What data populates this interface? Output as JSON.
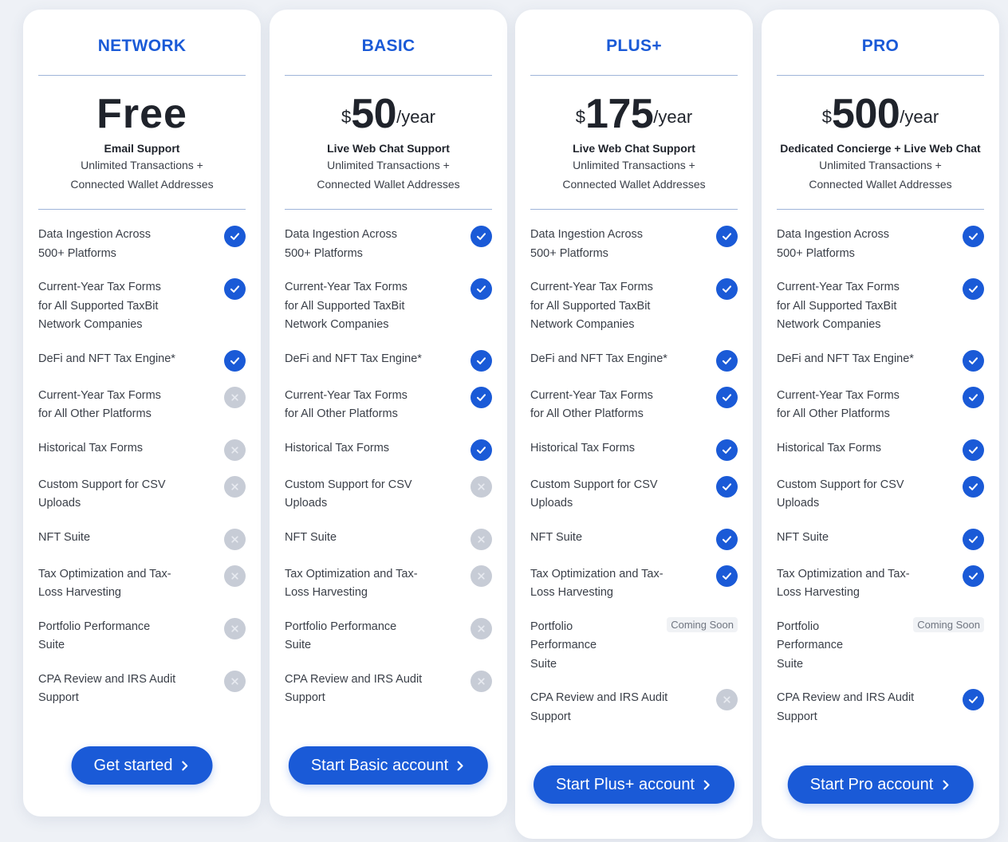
{
  "colors": {
    "accent": "#1a5ad7",
    "disabled": "#c7ccd6"
  },
  "plans": [
    {
      "tier": "NETWORK",
      "price": {
        "free_label": "Free",
        "currency": "",
        "amount": "",
        "period": ""
      },
      "support": "Email Support",
      "sub1": "Unlimited Transactions +",
      "sub2": "Connected Wallet Addresses",
      "features": [
        {
          "lines": [
            "Data Ingestion Across",
            "500+ Platforms"
          ],
          "status": "check-icon"
        },
        {
          "lines": [
            "Current-Year Tax Forms",
            "for All Supported TaxBit",
            "Network Companies"
          ],
          "status": "check-icon"
        },
        {
          "lines": [
            "DeFi and NFT Tax Engine*"
          ],
          "status": "check-icon"
        },
        {
          "lines": [
            "Current-Year Tax Forms",
            "for All Other Platforms"
          ],
          "status": "x-icon"
        },
        {
          "lines": [
            "Historical Tax Forms"
          ],
          "status": "x-icon"
        },
        {
          "lines": [
            "Custom Support for CSV",
            "Uploads"
          ],
          "status": "x-icon"
        },
        {
          "lines": [
            "NFT Suite"
          ],
          "status": "x-icon"
        },
        {
          "lines": [
            "Tax Optimization and Tax-",
            "Loss Harvesting"
          ],
          "status": "x-icon"
        },
        {
          "lines": [
            "Portfolio Performance",
            "Suite"
          ],
          "status": "x-icon"
        },
        {
          "lines": [
            "CPA Review and IRS Audit",
            "Support"
          ],
          "status": "x-icon"
        }
      ],
      "cta": "Get started"
    },
    {
      "tier": "BASIC",
      "price": {
        "free_label": "",
        "currency": "$",
        "amount": "50",
        "period": "/year"
      },
      "support": "Live Web Chat Support",
      "sub1": "Unlimited Transactions +",
      "sub2": "Connected Wallet Addresses",
      "features": [
        {
          "lines": [
            "Data Ingestion Across",
            "500+ Platforms"
          ],
          "status": "check-icon"
        },
        {
          "lines": [
            "Current-Year Tax Forms",
            "for All Supported TaxBit",
            "Network Companies"
          ],
          "status": "check-icon"
        },
        {
          "lines": [
            "DeFi and NFT Tax Engine*"
          ],
          "status": "check-icon"
        },
        {
          "lines": [
            "Current-Year Tax Forms",
            "for All Other Platforms"
          ],
          "status": "check-icon"
        },
        {
          "lines": [
            "Historical Tax Forms"
          ],
          "status": "check-icon"
        },
        {
          "lines": [
            "Custom Support for CSV",
            "Uploads"
          ],
          "status": "x-icon"
        },
        {
          "lines": [
            "NFT Suite"
          ],
          "status": "x-icon"
        },
        {
          "lines": [
            "Tax Optimization and Tax-",
            "Loss Harvesting"
          ],
          "status": "x-icon"
        },
        {
          "lines": [
            "Portfolio Performance",
            "Suite"
          ],
          "status": "x-icon"
        },
        {
          "lines": [
            "CPA Review and IRS Audit",
            "Support"
          ],
          "status": "x-icon"
        }
      ],
      "cta": "Start Basic account"
    },
    {
      "tier": "PLUS+",
      "price": {
        "free_label": "",
        "currency": "$",
        "amount": "175",
        "period": "/year"
      },
      "support": "Live Web Chat Support",
      "sub1": "Unlimited Transactions +",
      "sub2": "Connected Wallet Addresses",
      "features": [
        {
          "lines": [
            "Data Ingestion Across",
            "500+ Platforms"
          ],
          "status": "check-icon"
        },
        {
          "lines": [
            "Current-Year Tax Forms",
            "for All Supported TaxBit",
            "Network Companies"
          ],
          "status": "check-icon"
        },
        {
          "lines": [
            "DeFi and NFT Tax Engine*"
          ],
          "status": "check-icon"
        },
        {
          "lines": [
            "Current-Year Tax Forms",
            "for All Other Platforms"
          ],
          "status": "check-icon"
        },
        {
          "lines": [
            "Historical Tax Forms"
          ],
          "status": "check-icon"
        },
        {
          "lines": [
            "Custom Support for CSV",
            "Uploads"
          ],
          "status": "check-icon"
        },
        {
          "lines": [
            "NFT Suite"
          ],
          "status": "check-icon"
        },
        {
          "lines": [
            "Tax Optimization and Tax-",
            "Loss Harvesting"
          ],
          "status": "check-icon"
        },
        {
          "lines": [
            "Portfolio",
            "Performance",
            "Suite"
          ],
          "status": "badge",
          "badge": "Coming Soon"
        },
        {
          "lines": [
            "CPA Review and IRS Audit",
            "Support"
          ],
          "status": "x-icon"
        }
      ],
      "cta": "Start Plus+ account"
    },
    {
      "tier": "PRO",
      "price": {
        "free_label": "",
        "currency": "$",
        "amount": "500",
        "period": "/year"
      },
      "support": "Dedicated Concierge + Live Web Chat",
      "sub1": "Unlimited Transactions +",
      "sub2": "Connected Wallet Addresses",
      "features": [
        {
          "lines": [
            "Data Ingestion Across",
            "500+ Platforms"
          ],
          "status": "check-icon"
        },
        {
          "lines": [
            "Current-Year Tax Forms",
            "for All Supported TaxBit",
            "Network Companies"
          ],
          "status": "check-icon"
        },
        {
          "lines": [
            "DeFi and NFT Tax Engine*"
          ],
          "status": "check-icon"
        },
        {
          "lines": [
            "Current-Year Tax Forms",
            "for All Other Platforms"
          ],
          "status": "check-icon"
        },
        {
          "lines": [
            "Historical Tax Forms"
          ],
          "status": "check-icon"
        },
        {
          "lines": [
            "Custom Support for CSV",
            "Uploads"
          ],
          "status": "check-icon"
        },
        {
          "lines": [
            "NFT Suite"
          ],
          "status": "check-icon"
        },
        {
          "lines": [
            "Tax Optimization and Tax-",
            "Loss Harvesting"
          ],
          "status": "check-icon"
        },
        {
          "lines": [
            "Portfolio",
            "Performance",
            "Suite"
          ],
          "status": "badge",
          "badge": "Coming Soon"
        },
        {
          "lines": [
            "CPA Review and IRS Audit",
            "Support"
          ],
          "status": "check-icon"
        }
      ],
      "cta": "Start Pro account"
    }
  ]
}
